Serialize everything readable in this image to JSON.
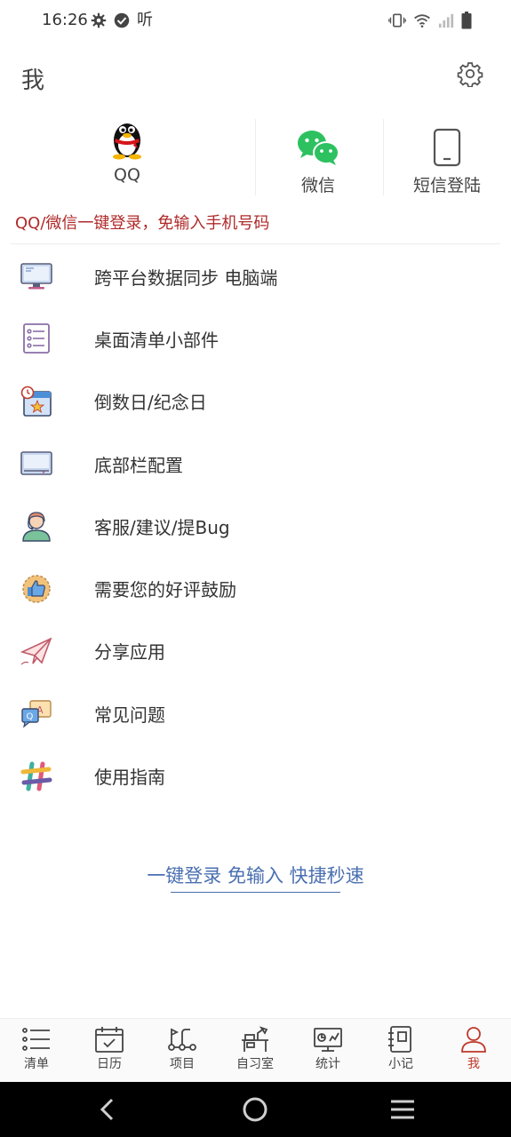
{
  "status_bar": {
    "time": "16:26",
    "listen_glyph": "听",
    "icons": [
      "gear-icon",
      "check-circle-icon",
      "vibrate-icon",
      "wifi-icon",
      "signal-icon",
      "battery-icon"
    ]
  },
  "header": {
    "title": "我",
    "settings_icon": "gear-icon"
  },
  "login": {
    "options": [
      {
        "label": "QQ",
        "icon": "qq-penguin-icon"
      },
      {
        "label": "微信",
        "icon": "wechat-icon"
      },
      {
        "label": "短信登陆",
        "icon": "phone-icon"
      }
    ],
    "hint": "QQ/微信一键登录，免输入手机号码",
    "hint_color": "#b02a2a"
  },
  "menu": {
    "items": [
      {
        "label": "跨平台数据同步 电脑端",
        "icon": "monitor-icon"
      },
      {
        "label": "桌面清单小部件",
        "icon": "checklist-icon"
      },
      {
        "label": "倒数日/纪念日",
        "icon": "calendar-star-icon"
      },
      {
        "label": "底部栏配置",
        "icon": "screen-panel-icon"
      },
      {
        "label": "客服/建议/提Bug",
        "icon": "support-agent-icon"
      },
      {
        "label": "需要您的好评鼓励",
        "icon": "thumbs-up-badge-icon"
      },
      {
        "label": "分享应用",
        "icon": "paper-plane-icon"
      },
      {
        "label": "常见问题",
        "icon": "qa-bubble-icon"
      },
      {
        "label": "使用指南",
        "icon": "slack-grid-icon"
      }
    ]
  },
  "promo": {
    "text": "一键登录 免输入 快捷秒速",
    "color": "#4a6fb0"
  },
  "tabbar": {
    "active_color": "#c0392b",
    "tabs": [
      {
        "label": "清单",
        "icon": "list-icon"
      },
      {
        "label": "日历",
        "icon": "calendar-icon"
      },
      {
        "label": "项目",
        "icon": "project-flow-icon"
      },
      {
        "label": "自习室",
        "icon": "desk-icon"
      },
      {
        "label": "统计",
        "icon": "stats-board-icon"
      },
      {
        "label": "小记",
        "icon": "notebook-icon"
      },
      {
        "label": "我",
        "icon": "person-icon",
        "active": true
      }
    ]
  },
  "navbar": {
    "buttons": [
      "back-icon",
      "home-icon",
      "menu-icon"
    ]
  }
}
